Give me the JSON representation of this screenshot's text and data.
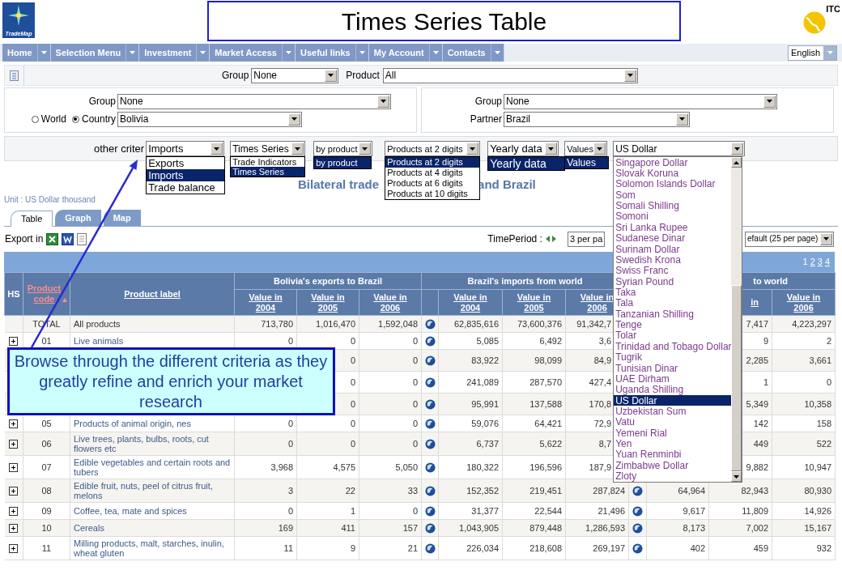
{
  "header": {
    "logo_label": "TradeMap",
    "title": "Times Series Table",
    "partner_logo_label": "ITC"
  },
  "nav": {
    "items": [
      "Home",
      "Selection Menu",
      "Investment",
      "Market Access",
      "Useful links",
      "My Account",
      "Contacts"
    ],
    "language": "English"
  },
  "product_filter": {
    "group_label": "Group",
    "group": "None",
    "product_label": "Product",
    "product": "All"
  },
  "reporter": {
    "group_label": "Group",
    "group": "None",
    "options": [
      {
        "label": "World",
        "selected": false
      },
      {
        "label": "Country",
        "selected": true
      }
    ],
    "country": "Bolivia"
  },
  "partner": {
    "group_label": "Group",
    "group": "None",
    "partner_label": "Partner",
    "partner": "Brazil"
  },
  "criteria": {
    "label": "other criter",
    "selects": [
      {
        "kind": "flow",
        "value": "Imports",
        "options": [
          {
            "label": "Exports",
            "selected": false
          },
          {
            "label": "Imports",
            "selected": true
          },
          {
            "label": "Trade balance",
            "selected": false
          }
        ]
      },
      {
        "kind": "indicator",
        "value": "Times Series",
        "options": [
          {
            "label": "Trade Indicators",
            "selected": false
          },
          {
            "label": "Times Series",
            "selected": true
          }
        ]
      },
      {
        "kind": "aggregation",
        "value": "by product",
        "options": [
          {
            "label": "by product",
            "selected": true
          }
        ]
      },
      {
        "kind": "level",
        "value": "Products at 2 digits",
        "options": [
          {
            "label": "Products at 2 digits",
            "selected": true
          },
          {
            "label": "Products at 4 digits",
            "selected": false
          },
          {
            "label": "Products at 6 digits",
            "selected": false
          },
          {
            "label": "Products at 10 digits",
            "selected": false
          }
        ]
      },
      {
        "kind": "period",
        "value": "Yearly data",
        "options": [
          {
            "label": "Yearly data",
            "selected": true
          }
        ]
      },
      {
        "kind": "measure",
        "value": "Values",
        "options": [
          {
            "label": "Values",
            "selected": true
          }
        ]
      },
      {
        "kind": "currency",
        "value": "US Dollar",
        "options": [
          {
            "label": "Singapore Dollar",
            "selected": false
          },
          {
            "label": "Slovak Koruna",
            "selected": false
          },
          {
            "label": "Solomon Islands Dollar",
            "selected": false
          },
          {
            "label": "Som",
            "selected": false
          },
          {
            "label": "Somali Shilling",
            "selected": false
          },
          {
            "label": "Somoni",
            "selected": false
          },
          {
            "label": "Sri Lanka Rupee",
            "selected": false
          },
          {
            "label": "Sudanese Dinar",
            "selected": false
          },
          {
            "label": "Surinam Dollar",
            "selected": false
          },
          {
            "label": "Swedish Krona",
            "selected": false
          },
          {
            "label": "Swiss Franc",
            "selected": false
          },
          {
            "label": "Syrian Pound",
            "selected": false
          },
          {
            "label": "Taka",
            "selected": false
          },
          {
            "label": "Tala",
            "selected": false
          },
          {
            "label": "Tanzanian Shilling",
            "selected": false
          },
          {
            "label": "Tenge",
            "selected": false
          },
          {
            "label": "Tolar",
            "selected": false
          },
          {
            "label": "Trinidad and Tobago Dollar",
            "selected": false
          },
          {
            "label": "Tugrik",
            "selected": false
          },
          {
            "label": "Tunisian Dinar",
            "selected": false
          },
          {
            "label": "UAE Dirham",
            "selected": false
          },
          {
            "label": "Uganda Shilling",
            "selected": false
          },
          {
            "label": "US Dollar",
            "selected": true
          },
          {
            "label": "Uzbekistan Sum",
            "selected": false
          },
          {
            "label": "Vatu",
            "selected": false
          },
          {
            "label": "Yemeni Rial",
            "selected": false
          },
          {
            "label": "Yen",
            "selected": false
          },
          {
            "label": "Yuan Renminbi",
            "selected": false
          },
          {
            "label": "Zimbabwe Dollar",
            "selected": false
          },
          {
            "label": "Zloty",
            "selected": false
          }
        ]
      }
    ]
  },
  "report_title": [
    "Bilateral trade",
    "and Brazil"
  ],
  "unit": "Unit : US Dollar thousand",
  "tabs": [
    {
      "label": "Table",
      "selected": true
    },
    {
      "label": "Graph",
      "selected": false
    },
    {
      "label": "Map",
      "selected": false
    }
  ],
  "export": {
    "label": "Export in"
  },
  "time_period": {
    "label": "TimePeriod :",
    "value": "3 per pa"
  },
  "page_size": "efault (25 per page)",
  "table": {
    "pages": [
      {
        "label": "1",
        "selected": true
      },
      {
        "label": "2",
        "selected": false
      },
      {
        "label": "3",
        "selected": false
      },
      {
        "label": "4",
        "selected": false
      }
    ],
    "hs": "HS",
    "code": "Product code",
    "label": "Product label",
    "groups": [
      {
        "title": "Bolivia's exports to Brazil",
        "columns": [
          "Value in 2004",
          "Value in 2005",
          "Value in 2006"
        ]
      },
      {
        "title": "Brazil's imports from world",
        "columns": [
          "Value in 2004",
          "Value in 2005",
          "Value in 2006"
        ]
      },
      {
        "title": "to world",
        "columns": [
          "in",
          "Value in 2006"
        ]
      }
    ],
    "rows": [
      {
        "kind": "total",
        "code": "TOTAL",
        "label": "All products",
        "b": [
          "713,780",
          "1,016,470",
          "1,592,048"
        ],
        "i": [
          "62,835,616",
          "73,600,376",
          "91,342,7"
        ],
        "w": [
          "7,417",
          "4,223,297"
        ]
      },
      {
        "kind": "chapter",
        "code": "01",
        "label": "Live animals",
        "b": [
          "0",
          "0",
          "0"
        ],
        "i": [
          "5,085",
          "6,492",
          "3,6"
        ],
        "w": [
          "9",
          "2"
        ]
      },
      {
        "kind": "covered",
        "b": [
          "0",
          "0"
        ],
        "i": [
          "83,922",
          "98,099",
          "84,9"
        ],
        "w": [
          "2,285",
          "3,661"
        ]
      },
      {
        "kind": "covered",
        "b": [
          "0",
          "0"
        ],
        "i": [
          "241,089",
          "287,570",
          "427,4"
        ],
        "w": [
          "1",
          "0"
        ]
      },
      {
        "kind": "covered",
        "b": [
          "0",
          "0"
        ],
        "i": [
          "95,991",
          "137,588",
          "170,8"
        ],
        "w": [
          "5,349",
          "10,358"
        ]
      },
      {
        "kind": "chapter",
        "code": "05",
        "label": "Products of animal origin, nes",
        "b": [
          "0",
          "0",
          "0"
        ],
        "i": [
          "59,076",
          "64,421",
          "72,9"
        ],
        "w": [
          "142",
          "158"
        ]
      },
      {
        "kind": "chapter",
        "code": "06",
        "label": "Live trees, plants, bulbs, roots, cut flowers etc",
        "b": [
          "0",
          "0",
          "0"
        ],
        "i": [
          "6,737",
          "5,622",
          "8,7"
        ],
        "w": [
          "449",
          "522"
        ]
      },
      {
        "kind": "chapter",
        "code": "07",
        "label": "Edible vegetables and certain roots and tubers",
        "b": [
          "3,968",
          "4,575",
          "5,050"
        ],
        "i": [
          "180,322",
          "196,596",
          "187,9"
        ],
        "w": [
          "9,882",
          "10,947"
        ]
      },
      {
        "kind": "chapter",
        "code": "08",
        "label": "Edible fruit, nuts, peel of citrus fruit, melons",
        "b": [
          "3",
          "22",
          "33"
        ],
        "i": [
          "152,352",
          "219,451",
          "287,824"
        ],
        "w": [
          "64,964",
          "82,943",
          "80,930"
        ]
      },
      {
        "kind": "chapter",
        "code": "09",
        "label": "Coffee, tea, mate and spices",
        "b": [
          "0",
          "1",
          "0"
        ],
        "i": [
          "31,377",
          "22,544",
          "21,496"
        ],
        "w": [
          "9,617",
          "11,809",
          "14,926"
        ]
      },
      {
        "kind": "chapter",
        "code": "10",
        "label": "Cereals",
        "b": [
          "169",
          "411",
          "157"
        ],
        "i": [
          "1,043,905",
          "879,448",
          "1,286,593"
        ],
        "w": [
          "8,173",
          "7,002",
          "15,167"
        ]
      },
      {
        "kind": "chapter",
        "code": "11",
        "label": "Milling products, malt, starches, inulin, wheat gluten",
        "b": [
          "11",
          "9",
          "21"
        ],
        "i": [
          "226,034",
          "218,608",
          "269,197"
        ],
        "w": [
          "402",
          "459",
          "932"
        ]
      }
    ]
  },
  "callout": "Browse through the different criteria as they greatly refine and enrich your market research"
}
